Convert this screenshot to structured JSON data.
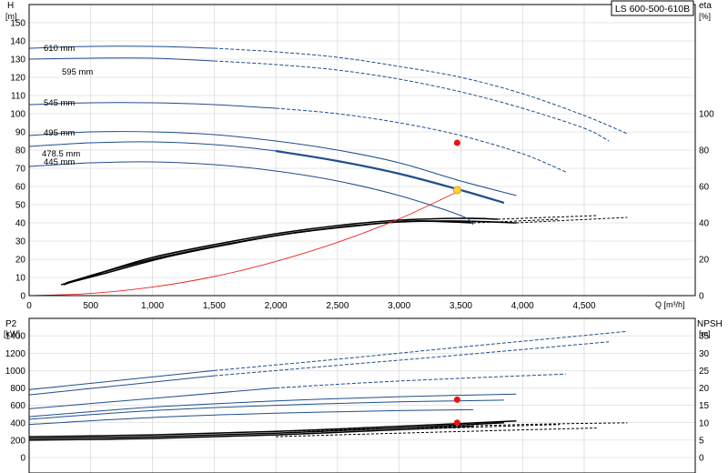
{
  "model_label": "LS 600-500-610B",
  "chart_data": [
    {
      "type": "line",
      "name": "head-efficiency",
      "x_unit_label": "Q [m³/h]",
      "y_label_top": "H",
      "y_unit": "[m]",
      "y2_label_top": "eta",
      "y2_unit": "[%]",
      "xlim": [
        0,
        5400
      ],
      "ylim": [
        0,
        160
      ],
      "y2lim": [
        0,
        160
      ],
      "x_ticks": [
        0,
        500,
        1000,
        1500,
        2000,
        2500,
        3000,
        3500,
        4000,
        4500
      ],
      "x_tick_labels": [
        "0",
        "500",
        "1,000",
        "1,500",
        "2,000",
        "2,500",
        "3,000",
        "3,500",
        "4,000",
        "4,500"
      ],
      "y_ticks": [
        0,
        10,
        20,
        30,
        40,
        50,
        60,
        70,
        80,
        90,
        100,
        110,
        120,
        130,
        140,
        150
      ],
      "y2_ticks": [
        0,
        20,
        40,
        60,
        80,
        100
      ],
      "grid": true,
      "head_curves": [
        {
          "name": "610 mm",
          "solid": [
            [
              0,
              136
            ],
            [
              500,
              137
            ],
            [
              1000,
              137
            ],
            [
              1500,
              136
            ]
          ],
          "dashed": [
            [
              1500,
              136
            ],
            [
              2000,
              134
            ],
            [
              2500,
              131
            ],
            [
              3000,
              126
            ],
            [
              3500,
              120
            ],
            [
              4000,
              111
            ],
            [
              4500,
              99
            ],
            [
              4850,
              89
            ]
          ]
        },
        {
          "name": "595 mm",
          "solid": [
            [
              0,
              130
            ],
            [
              500,
              130.5
            ],
            [
              1000,
              130.5
            ],
            [
              1500,
              129
            ]
          ],
          "dashed": [
            [
              1500,
              129
            ],
            [
              2000,
              127
            ],
            [
              2500,
              124
            ],
            [
              3000,
              119
            ],
            [
              3500,
              112
            ],
            [
              4000,
              103
            ],
            [
              4500,
              92
            ],
            [
              4700,
              85
            ]
          ]
        },
        {
          "name": "545 mm",
          "solid": [
            [
              0,
              105
            ],
            [
              500,
              106
            ],
            [
              1000,
              106
            ],
            [
              1500,
              105
            ],
            [
              2000,
              103
            ]
          ],
          "dashed": [
            [
              2000,
              103
            ],
            [
              2500,
              100
            ],
            [
              3000,
              95
            ],
            [
              3500,
              88
            ],
            [
              4000,
              78
            ],
            [
              4350,
              68
            ]
          ]
        },
        {
          "name": "495 mm",
          "solid": [
            [
              0,
              88
            ],
            [
              500,
              90
            ],
            [
              1000,
              90
            ],
            [
              1500,
              88.5
            ],
            [
              2000,
              85
            ],
            [
              2500,
              80
            ],
            [
              3000,
              73
            ],
            [
              3500,
              63
            ],
            [
              3950,
              55
            ]
          ],
          "dashed": []
        },
        {
          "name": "478.5 mm",
          "solid": [
            [
              0,
              82
            ],
            [
              500,
              84
            ],
            [
              1000,
              84.5
            ],
            [
              1500,
              83
            ],
            [
              2000,
              79.5
            ],
            [
              2500,
              74
            ],
            [
              3000,
              67
            ],
            [
              3500,
              58
            ],
            [
              3850,
              51
            ]
          ],
          "dashed": [],
          "bold_from": 1600
        },
        {
          "name": "445 mm",
          "solid": [
            [
              0,
              71
            ],
            [
              500,
              73
            ],
            [
              1000,
              73.5
            ],
            [
              1500,
              72
            ],
            [
              2000,
              68.5
            ],
            [
              2500,
              63
            ],
            [
              3000,
              55
            ],
            [
              3500,
              44
            ],
            [
              3600,
              39
            ]
          ],
          "dashed": []
        }
      ],
      "efficiency_curves": [
        {
          "solid": [
            [
              280,
              6
            ],
            [
              500,
              11
            ],
            [
              1000,
              20
            ],
            [
              1500,
              27
            ],
            [
              2000,
              33
            ],
            [
              2500,
              37.5
            ],
            [
              3000,
              40.5
            ],
            [
              3500,
              41
            ],
            [
              3950,
              40
            ]
          ],
          "dashed": [
            [
              3950,
              40
            ],
            [
              4850,
              43
            ]
          ]
        },
        {
          "solid": [
            [
              300,
              7
            ],
            [
              600,
              13
            ],
            [
              1000,
              21
            ],
            [
              1500,
              28
            ],
            [
              2000,
              34
            ],
            [
              2500,
              38.5
            ],
            [
              3000,
              41.5
            ],
            [
              3500,
              42.5
            ],
            [
              3800,
              42
            ]
          ],
          "dashed": [
            [
              3800,
              42
            ],
            [
              4600,
              44
            ]
          ]
        },
        {
          "solid": [
            [
              260,
              6
            ],
            [
              600,
              12
            ],
            [
              1100,
              21
            ],
            [
              1600,
              28
            ],
            [
              2100,
              34
            ],
            [
              2600,
              38
            ],
            [
              3100,
              41
            ],
            [
              3600,
              40
            ]
          ],
          "dashed": [
            [
              3600,
              40
            ],
            [
              4300,
              42
            ]
          ]
        }
      ],
      "system_curve": {
        "points": [
          [
            0,
            0
          ],
          [
            500,
            1.2
          ],
          [
            1000,
            4.7
          ],
          [
            1500,
            10.5
          ],
          [
            2000,
            18.8
          ],
          [
            2500,
            29.3
          ],
          [
            3000,
            42.2
          ],
          [
            3470,
            57
          ]
        ]
      },
      "duty_point": {
        "q": 3470,
        "h": 58
      },
      "eta_point": {
        "q": 3470,
        "eta": 84
      }
    },
    {
      "type": "line",
      "name": "power-npsh",
      "y_label_top": "P2",
      "y_unit": "[kW]",
      "y2_label_top": "NPSH",
      "y2_unit": "[m]",
      "xlim": [
        0,
        5400
      ],
      "ylim": [
        0,
        1600
      ],
      "y2lim": [
        0,
        40
      ],
      "y_ticks": [
        0,
        200,
        400,
        600,
        800,
        1000,
        1200,
        1400
      ],
      "y2_ticks": [
        0,
        5,
        10,
        15,
        20,
        25,
        30,
        35
      ],
      "grid": true,
      "power_curves": [
        {
          "name": "610 mm",
          "solid": [
            [
              0,
              780
            ],
            [
              1500,
              1000
            ]
          ],
          "dashed": [
            [
              1500,
              1000
            ],
            [
              2500,
              1130
            ],
            [
              3500,
              1270
            ],
            [
              4850,
              1450
            ]
          ]
        },
        {
          "name": "595 mm",
          "solid": [
            [
              0,
              720
            ],
            [
              1500,
              940
            ]
          ],
          "dashed": [
            [
              1500,
              940
            ],
            [
              2500,
              1060
            ],
            [
              3500,
              1180
            ],
            [
              4700,
              1330
            ]
          ]
        },
        {
          "name": "545 mm",
          "solid": [
            [
              0,
              560
            ],
            [
              2000,
              800
            ]
          ],
          "dashed": [
            [
              2000,
              800
            ],
            [
              3000,
              880
            ],
            [
              4350,
              960
            ]
          ]
        },
        {
          "name": "495 mm",
          "solid": [
            [
              0,
              470
            ],
            [
              1000,
              580
            ],
            [
              2000,
              650
            ],
            [
              3000,
              700
            ],
            [
              3950,
              730
            ]
          ],
          "dashed": []
        },
        {
          "name": "478.5 mm",
          "solid": [
            [
              0,
              440
            ],
            [
              1000,
              540
            ],
            [
              2000,
              600
            ],
            [
              3000,
              640
            ],
            [
              3850,
              660
            ]
          ],
          "dashed": []
        },
        {
          "name": "445 mm",
          "solid": [
            [
              0,
              380
            ],
            [
              1000,
              460
            ],
            [
              2000,
              510
            ],
            [
              3000,
              540
            ],
            [
              3600,
              550
            ]
          ],
          "dashed": []
        }
      ],
      "npsh_curves": [
        {
          "solid": [
            [
              0,
              6
            ],
            [
              1000,
              6.5
            ],
            [
              2000,
              7.5
            ],
            [
              3000,
              9
            ],
            [
              3950,
              10.5
            ]
          ],
          "dashed": [
            [
              2000,
              7.5
            ],
            [
              3000,
              8.5
            ],
            [
              4000,
              9.5
            ],
            [
              4850,
              10
            ]
          ]
        },
        {
          "solid": [
            [
              0,
              5.5
            ],
            [
              1000,
              6
            ],
            [
              2000,
              7
            ],
            [
              3000,
              8.5
            ],
            [
              3850,
              10
            ]
          ],
          "dashed": [
            [
              2000,
              6.5
            ],
            [
              3000,
              8
            ],
            [
              4300,
              9.5
            ]
          ]
        },
        {
          "solid": [
            [
              0,
              5
            ],
            [
              1000,
              5.5
            ],
            [
              2000,
              6.5
            ],
            [
              3000,
              8
            ],
            [
              3600,
              9
            ]
          ],
          "dashed": [
            [
              2000,
              6
            ],
            [
              3000,
              7
            ],
            [
              4600,
              8.5
            ]
          ]
        }
      ],
      "power_point": {
        "q": 3470,
        "p2": 665
      },
      "npsh_point": {
        "q": 3470,
        "npsh": 10
      }
    }
  ],
  "colors": {
    "blue": "#1f4e8c",
    "black": "#000000",
    "grid": "#cfcfcf",
    "system": "#ee2222",
    "duty_fill": "#ffd23f",
    "duty_stroke": "#e0a000",
    "marker": "#ee1111"
  }
}
